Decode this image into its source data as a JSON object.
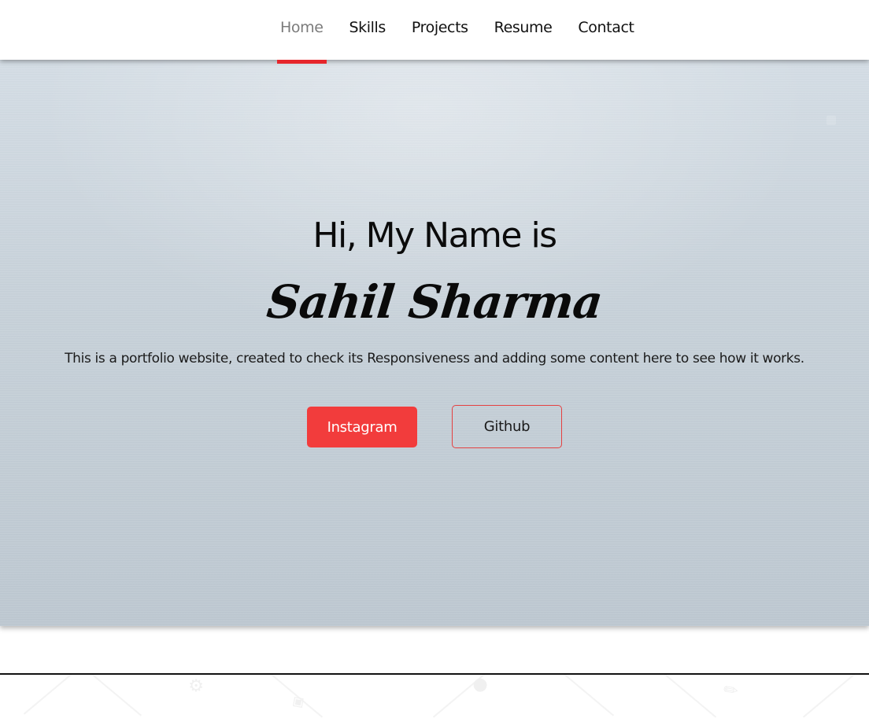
{
  "nav": {
    "items": [
      {
        "label": "Home",
        "active": true
      },
      {
        "label": "Skills",
        "active": false
      },
      {
        "label": "Projects",
        "active": false
      },
      {
        "label": "Resume",
        "active": false
      },
      {
        "label": "Contact",
        "active": false
      }
    ],
    "active_color": "#7b7b7b",
    "underline_color": "#e6262b"
  },
  "hero": {
    "greeting": "Hi, My Name is",
    "name": "Sahil Sharma",
    "description": "This is a portfolio website, created to check its Responsiveness and adding some content here to see how it works.",
    "primary_button": "Instagram",
    "secondary_button": "Github",
    "accent_color": "#f23c3c"
  }
}
